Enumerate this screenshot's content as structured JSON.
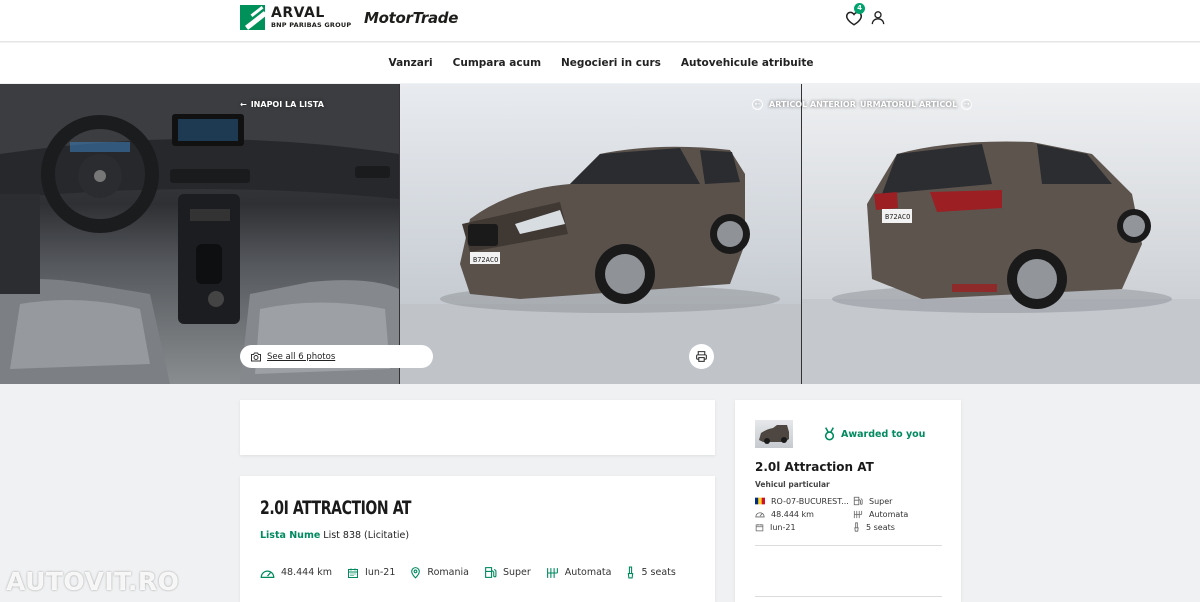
{
  "header": {
    "arval_brand": "ARVAL",
    "arval_sub": "BNP PARIBAS GROUP",
    "motortrade_brand": "MotorTrade",
    "favorites_count": "4"
  },
  "nav": {
    "items": [
      "Vanzari",
      "Cumpara acum",
      "Negocieri in curs",
      "Autovehicule atribuite"
    ]
  },
  "gallery": {
    "back_label": "INAPOI LA LISTA",
    "prev_label": "ARTICOL ANTERIOR",
    "next_label": "URMATORUL ARTICOL",
    "see_all_label": "See all 6 photos",
    "plate_text": "B72ACO"
  },
  "watermark": "AUTOVIT.RO",
  "listing": {
    "title": "2.0I ATTRACTION AT",
    "list_key": "Lista Nume",
    "list_value": "List 838 (Licitatie)",
    "specs": {
      "mileage": "48.444 km",
      "date": "Iun-21",
      "location": "Romania",
      "fuel": "Super",
      "transmission": "Automata",
      "seats": "5 seats"
    }
  },
  "side": {
    "awarded_label": "Awarded to you",
    "title": "2.0l Attraction AT",
    "subtitle": "Vehicul particular",
    "details": {
      "location": "RO-07-BUCUREST...",
      "fuel": "Super",
      "mileage": "48.444 km",
      "transmission": "Automata",
      "date": "Iun-21",
      "seats": "5 seats"
    }
  },
  "colors": {
    "accent_green": "#008a5e",
    "badge_green": "#00a26e",
    "arval_green": "#00915a"
  }
}
